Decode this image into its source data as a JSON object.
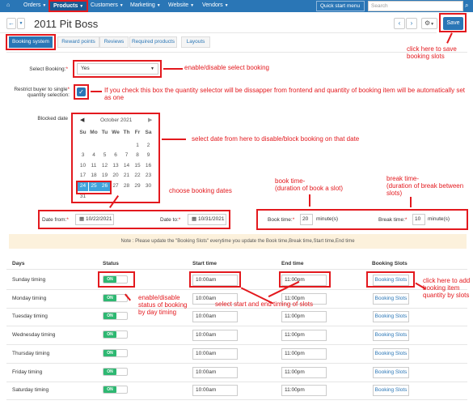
{
  "topnav": {
    "orders": "Orders",
    "products": "Products",
    "customers": "Customers",
    "marketing": "Marketing",
    "website": "Website",
    "vendors": "Vendors",
    "quick_start": "Quick start menu",
    "search_placeholder": "Search"
  },
  "page": {
    "title": "2011 Pit Boss",
    "save": "Save"
  },
  "tabs": [
    "Booking system",
    "Reward points",
    "Reviews",
    "Required products",
    "Layouts"
  ],
  "form": {
    "select_booking_label": "Select Booking:",
    "select_booking_value": "Yes",
    "restrict_label_1": "Restrict buyer to single",
    "restrict_label_2": "quantity selection:",
    "blocked_label": "Blocked date",
    "date_from_label": "Date from:",
    "date_from_value": "10/22/2021",
    "date_to_label": "Date to:",
    "date_to_value": "10/31/2021",
    "book_time_label": "Book time:",
    "book_time_value": "20",
    "book_time_unit": "minute(s)",
    "break_time_label": "Break time:",
    "break_time_value": "10",
    "break_time_unit": "minute(s)",
    "note": "Note : Please update the \"Booking Slots\" everytime you update the Book time,Break time,Start time,End time"
  },
  "calendar": {
    "month": "October 2021",
    "weekdays": [
      "Su",
      "Mo",
      "Tu",
      "We",
      "Th",
      "Fr",
      "Sa"
    ],
    "weeks": [
      [
        "",
        "",
        "",
        "",
        "",
        "1",
        "2"
      ],
      [
        "3",
        "4",
        "5",
        "6",
        "7",
        "8",
        "9"
      ],
      [
        "10",
        "11",
        "12",
        "13",
        "14",
        "15",
        "16"
      ],
      [
        "17",
        "18",
        "19",
        "20",
        "21",
        "22",
        "23"
      ],
      [
        "24",
        "25",
        "26",
        "27",
        "28",
        "29",
        "30"
      ],
      [
        "31",
        "",
        "",
        "",
        "",
        "",
        ""
      ]
    ],
    "highlighted": [
      "24",
      "25",
      "26"
    ]
  },
  "table": {
    "headers": {
      "days": "Days",
      "status": "Status",
      "start": "Start time",
      "end": "End time",
      "slots": "Booking Slots"
    },
    "toggle_on": "ON",
    "slot_button": "Booking Slots",
    "rows": [
      {
        "day": "Sunday timing",
        "start": "10:00am",
        "end": "11:00pm"
      },
      {
        "day": "Monday timing",
        "start": "10:00am",
        "end": "11:00pm"
      },
      {
        "day": "Tuesday timing",
        "start": "10:00am",
        "end": "11:00pm"
      },
      {
        "day": "Wednesday timing",
        "start": "10:00am",
        "end": "11:00pm"
      },
      {
        "day": "Thursday timing",
        "start": "10:00am",
        "end": "11:00pm"
      },
      {
        "day": "Friday timing",
        "start": "10:00am",
        "end": "11:00pm"
      },
      {
        "day": "Saturday timing",
        "start": "10:00am",
        "end": "11:00pm"
      }
    ]
  },
  "annotations": {
    "save": "click here to save booking slots",
    "select": "enable/disable select booking",
    "restrict": "If you check this box the quantity selector will be dissapper from frontend and quantity of booking item will be automatically set as one",
    "blocked": "select date from here to disable/block booking on that date",
    "choose_dates": "choose booking dates",
    "book_time_1": "book time-",
    "book_time_2": "(duration of book a slot)",
    "break_time_1": "break time-",
    "break_time_2": "(duration of break between slots)",
    "status": "enable/disable status of booking by day timing",
    "times": "select start and end timing of slots",
    "slots": "click here to add booking item quantity by slots"
  },
  "colors": {
    "primary": "#2a76b6",
    "annotation": "#e3191e",
    "toggle_on": "#2eb872"
  }
}
